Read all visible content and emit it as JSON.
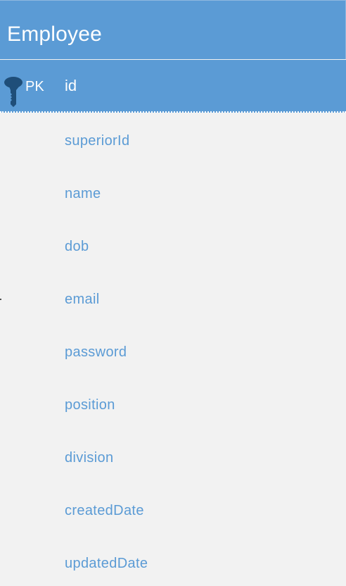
{
  "entity": {
    "title": "Employee",
    "primary_key": {
      "label": "PK",
      "field": "id",
      "icon": "key-icon"
    },
    "fields": [
      "superiorId",
      "name",
      "dob",
      "email",
      "password",
      "position",
      "division",
      "createdDate",
      "updatedDate"
    ]
  },
  "colors": {
    "header": "#5b9bd5",
    "body": "#f2f2f2",
    "header_text": "#ffffff",
    "field_text": "#5b9bd5",
    "icon": "#1f4e79"
  }
}
